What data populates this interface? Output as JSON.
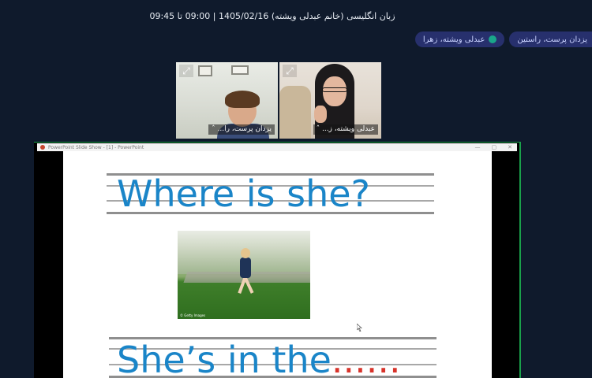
{
  "meeting": {
    "title": "زبان انگلیسی (خانم عبدلی ویشته) 1405/02/16 | 09:00 تا 09:45"
  },
  "participant_chips": [
    {
      "label": "یزدان پرست، راستین",
      "speaking": false
    },
    {
      "label": "عبدلی ویشته، زهرا",
      "speaking": true
    }
  ],
  "video_tiles": [
    {
      "name": "عبدلی ویشته، ز...",
      "expand_icon": "expand-icon"
    },
    {
      "name": "یزدان پرست، را...",
      "expand_icon": "expand-icon"
    }
  ],
  "screen_share": {
    "window_title": "PowerPoint Slide Show - [1] - PowerPoint",
    "controls": [
      "minimize-icon",
      "maximize-icon",
      "close-icon"
    ],
    "slide": {
      "question": "Where is she?",
      "answer_prefix": "She’s in the",
      "answer_blank": "......",
      "photo_credit": "© Getty Images"
    }
  },
  "colors": {
    "background": "#0f1a2c",
    "chip": "#27306d",
    "slide_text": "#1a85c8",
    "blank": "#d8332a",
    "share_border": "#1aa14b"
  }
}
